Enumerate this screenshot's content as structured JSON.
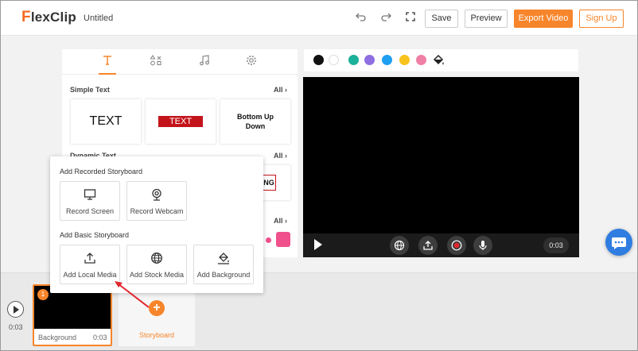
{
  "app": {
    "logo_text": "lexClip",
    "logo_letter": "F",
    "document_title": "Untitled"
  },
  "toolbar": {
    "undo_icon": "undo-icon",
    "redo_icon": "redo-icon",
    "fullscreen_icon": "fullscreen-icon",
    "save_label": "Save",
    "preview_label": "Preview",
    "export_label": "Export Video",
    "signup_label": "Sign Up"
  },
  "text_panel": {
    "tabs": [
      {
        "icon": "text-icon",
        "active": true
      },
      {
        "icon": "shapes-icon",
        "active": false
      },
      {
        "icon": "music-icon",
        "active": false
      },
      {
        "icon": "settings-icon",
        "active": false
      }
    ],
    "simple_text": {
      "title": "Simple Text",
      "all_label": "All",
      "items": [
        "TEXT",
        "TEXT",
        "Bottom Up\nDown"
      ]
    },
    "dynamic_text": {
      "title": "Dynamic Text",
      "all_label": "All",
      "peek": "NG"
    },
    "third_section": {
      "all_label": "All"
    }
  },
  "colors": {
    "swatches": [
      "#111111",
      "#ffffff",
      "#1bb09a",
      "#8e6ee0",
      "#1e9ff2",
      "#f7c21c",
      "#f07fa5"
    ],
    "fill_icon": "paint-bucket-icon",
    "accent": "#f7852b",
    "chat": "#2f7de1"
  },
  "video_controls": {
    "play_icon": "play-icon",
    "globe_icon": "globe-icon",
    "upload_icon": "upload-icon",
    "record_icon": "record-icon",
    "mic_icon": "microphone-icon",
    "time": "0:03"
  },
  "popup": {
    "recorded_title": "Add Recorded Storyboard",
    "record_screen": "Record Screen",
    "record_webcam": "Record Webcam",
    "basic_title": "Add Basic Storyboard",
    "add_local_media": "Add Local Media",
    "add_stock_media": "Add Stock Media",
    "add_background": "Add Background"
  },
  "timeline": {
    "time": "0:03",
    "clip_badge": "1",
    "clip_label": "Background",
    "clip_duration": "0:03",
    "storyboard_label": "Storyboard",
    "plus_icon": "+"
  }
}
